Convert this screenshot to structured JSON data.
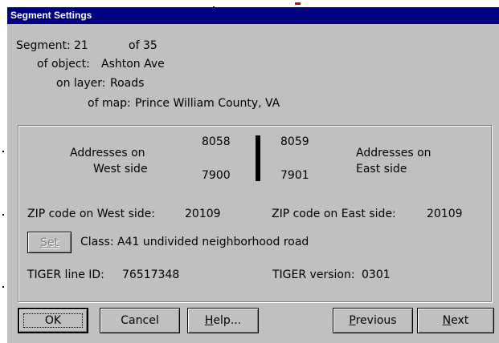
{
  "window": {
    "title": "Segment Settings"
  },
  "segment": {
    "label": "Segment:",
    "number": "21",
    "of_label": "of 35",
    "object_label": "of object:",
    "object_value": "Ashton Ave",
    "layer_label": "on layer:",
    "layer_value": "Roads",
    "map_label": "of map:",
    "map_value": "Prince William County, VA"
  },
  "addresses": {
    "west_label_line1": "Addresses on",
    "west_label_line2": "West side",
    "west_high": "8058",
    "west_low": "7900",
    "east_high": "8059",
    "east_low": "7901",
    "east_label_line1": "Addresses on",
    "east_label_line2": "East side"
  },
  "zip": {
    "west_label": "ZIP code on West side:",
    "west_value": "20109",
    "east_label": "ZIP code on East side:",
    "east_value": "20109"
  },
  "class": {
    "set_button": "Set",
    "label": "Class:",
    "value": "A41 undivided neighborhood road"
  },
  "tiger": {
    "line_id_label": "TIGER line ID:",
    "line_id_value": "76517348",
    "version_label": "TIGER version:",
    "version_value": "0301"
  },
  "buttons": {
    "ok": "OK",
    "cancel": "Cancel",
    "help_u": "H",
    "help_rest": "elp...",
    "previous_u": "P",
    "previous_rest": "revious",
    "next_u": "N",
    "next_rest": "ext"
  },
  "colors": {
    "titlebar": "#000080",
    "dialog_face": "#c0c0c0"
  }
}
